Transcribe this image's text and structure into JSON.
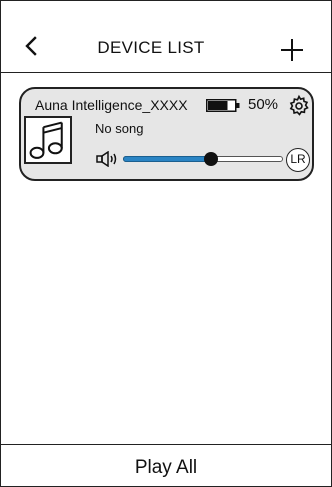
{
  "header": {
    "title": "DEVICE LIST",
    "back_icon": "chevron-left-icon",
    "add_icon": "plus-icon"
  },
  "devices": [
    {
      "name": "Auna Intelligence_XXXX",
      "battery_percent_text": "50%",
      "battery_level": 0.75,
      "song": "No song",
      "volume_level": 0.55,
      "channel_label": "LR",
      "album_icon": "music-note-icon",
      "settings_icon": "gear-icon",
      "volume_icon": "speaker-icon"
    }
  ],
  "footer": {
    "play_all_label": "Play All"
  },
  "colors": {
    "card_background": "#e6e6e6",
    "slider_fill": "#2a84c4",
    "border": "#222222"
  }
}
